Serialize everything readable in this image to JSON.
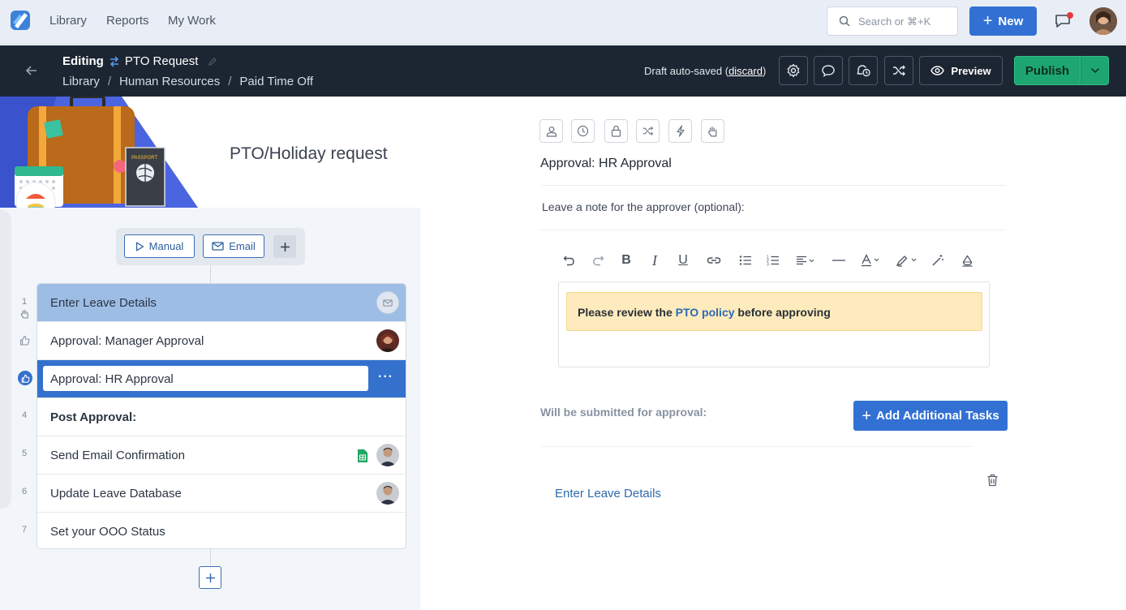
{
  "topnav": {
    "links": [
      "Library",
      "Reports",
      "My Work"
    ],
    "search_placeholder": "Search or ⌘+K",
    "new_label": "New"
  },
  "editbar": {
    "editing_label": "Editing",
    "template_title": "PTO Request",
    "breadcrumb": [
      "Library",
      "Human Resources",
      "Paid Time Off"
    ],
    "draft_text": "Draft auto-saved",
    "discard_label": "discard",
    "preview_label": "Preview",
    "publish_label": "Publish"
  },
  "hero": {
    "title": "PTO/Holiday request"
  },
  "triggers": {
    "manual_label": "Manual",
    "email_label": "Email"
  },
  "steps": [
    {
      "num": "1",
      "label": "Enter Leave Details"
    },
    {
      "num": "",
      "label": "Approval: Manager Approval"
    },
    {
      "num": "",
      "label": "Approval: HR Approval"
    },
    {
      "num": "4",
      "label": "Post Approval:"
    },
    {
      "num": "5",
      "label": "Send Email Confirmation"
    },
    {
      "num": "6",
      "label": "Update Leave Database"
    },
    {
      "num": "7",
      "label": "Set your OOO Status"
    }
  ],
  "step_actions": {
    "more": "···"
  },
  "detail": {
    "title": "Approval: HR Approval",
    "note_label": "Leave a note for the approver (optional):",
    "callout_prefix": "Please review the ",
    "callout_link": "PTO policy",
    "callout_suffix": " before approving",
    "submit_label": "Will be submitted for approval:",
    "add_tasks_label": "Add Additional Tasks",
    "task_link": "Enter Leave Details"
  },
  "colors": {
    "primary": "#3271d3",
    "publish": "#1ea672",
    "editbar_bg": "#1c2632",
    "selected_step": "#3471cc",
    "first_step": "#9dbde5",
    "callout_bg": "#fdebbd"
  }
}
